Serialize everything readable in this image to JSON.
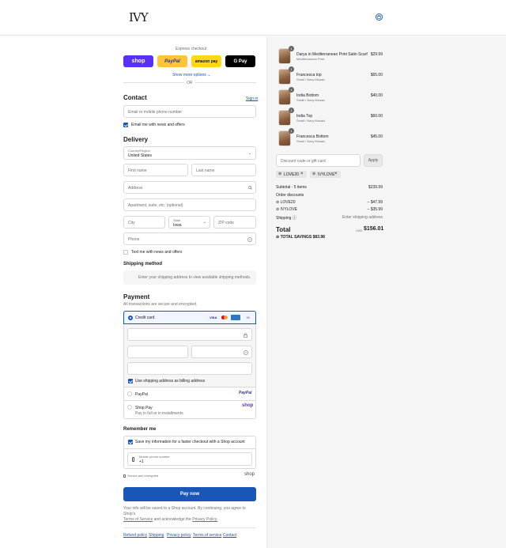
{
  "header": {
    "logo": "IVY",
    "cart_icon": "bag-icon"
  },
  "express": {
    "title": "Express checkout",
    "shop": "shop",
    "paypal": "PayPal",
    "amazon": "amazon pay",
    "gpay": "G Pay",
    "show_more": "Show more options ⌄",
    "or": "OR"
  },
  "contact": {
    "title": "Contact",
    "signin": "Sign in",
    "email_placeholder": "Email or mobile phone number",
    "news_label": "Email me with news and offers"
  },
  "delivery": {
    "title": "Delivery",
    "country_label": "Country/Region",
    "country_value": "United States",
    "first_name": "First name",
    "last_name": "Last name",
    "address": "Address",
    "apartment": "Apartment, suite, etc. (optional)",
    "city": "City",
    "state_label": "State",
    "state_value": "Iowa",
    "zip": "ZIP code",
    "phone": "Phone",
    "text_label": "Text me with news and offers"
  },
  "shipping": {
    "title": "Shipping method",
    "notice": "Enter your shipping address to view available shipping methods."
  },
  "payment": {
    "title": "Payment",
    "subtitle": "All transactions are secure and encrypted.",
    "credit_card": "Credit card",
    "more_cards": "+5",
    "card_brands": [
      "VISA",
      "MC",
      "AMEX"
    ],
    "billing_label": "Use shipping address as billing address",
    "paypal": "PayPal",
    "paypal_logo": "PayPal",
    "shoppay": "Shop Pay",
    "shoppay_sub": "Pay in full or in installments",
    "shoppay_logo": "shop"
  },
  "remember": {
    "title": "Remember me",
    "save_label": "Save my information for a faster checkout with a Shop account",
    "mobile_label": "Mobile phone number",
    "mobile_value": "+1",
    "secure": "Secure and encrypted",
    "shop_logo": "shop"
  },
  "paynow": {
    "label": "Pay now"
  },
  "legal": {
    "line1": "Your info will be saved to a Shop account. By continuing, you agree to Shop's",
    "tos": "Terms of Service",
    "and": "and acknowledge the",
    "privacy": "Privacy Policy."
  },
  "footer": {
    "links": [
      "Refund policy",
      "Shipping",
      "Privacy policy",
      "Terms of service",
      "Contact"
    ]
  },
  "cart": {
    "items": [
      {
        "name": "Darya in Mediterranean Print Satin Scarf",
        "variant": "Mediterranean Print",
        "price": "$29.99",
        "qty": "1"
      },
      {
        "name": "Francesca top",
        "variant": "Small / Navy Mosaic",
        "price": "$65.00",
        "qty": "1"
      },
      {
        "name": "India Bottom",
        "variant": "Small / Navy Mosaic",
        "price": "$40.00",
        "qty": "1"
      },
      {
        "name": "India Top",
        "variant": "Small / Navy Mosaic",
        "price": "$60.00",
        "qty": "1"
      },
      {
        "name": "Francesca Bottom",
        "variant": "Small / Navy Mosaic",
        "price": "$45.00",
        "qty": "1"
      }
    ],
    "discount_placeholder": "Discount code or gift card",
    "apply": "Apply",
    "codes": [
      "LOVE20",
      "IVYLOVE"
    ],
    "subtotal_label": "Subtotal · 5 items",
    "subtotal_value": "$239.99",
    "order_discounts": "Order discounts",
    "discount_rows": [
      {
        "code": "LOVE20",
        "amount": "– $47.99"
      },
      {
        "code": "IVYLOVE",
        "amount": "– $35.99"
      }
    ],
    "shipping_label": "Shipping",
    "shipping_value": "Enter shipping address",
    "total_label": "Total",
    "currency": "USD",
    "total_value": "$156.01",
    "savings_label": "TOTAL SAVINGS",
    "savings_value": "$83.98"
  },
  "colors": {
    "accent": "#1a56b8",
    "shop_purple": "#5a31f4",
    "paypal_yellow": "#ffc439"
  }
}
